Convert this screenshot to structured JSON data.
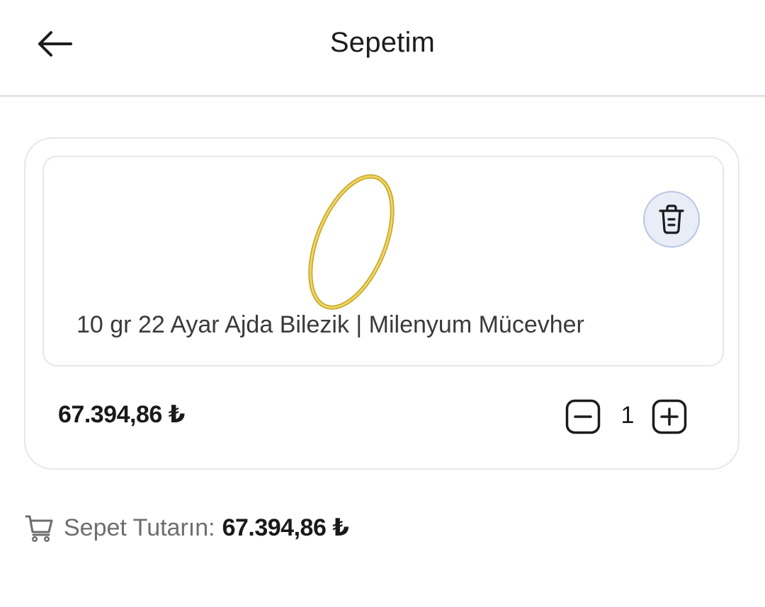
{
  "header": {
    "title": "Sepetim",
    "back_icon": "arrow-left-icon"
  },
  "cart": {
    "items": [
      {
        "name": "10 gr 22 Ayar Ajda Bilezik | Milenyum Mücevher",
        "price": "67.394,86 ₺",
        "quantity": "1",
        "image_icon": "gold-bangle-image",
        "delete_icon": "trash-icon",
        "minus_icon": "minus-square-icon",
        "plus_icon": "plus-square-icon"
      }
    ]
  },
  "summary": {
    "icon": "cart-icon",
    "label": "Sepet Tutarın:",
    "total": "67.394,86 ₺"
  },
  "colors": {
    "gold": "#e3c64a",
    "delete_bg": "#e8edf7",
    "delete_border": "#b9c5e4",
    "border": "#e6e7ea"
  }
}
